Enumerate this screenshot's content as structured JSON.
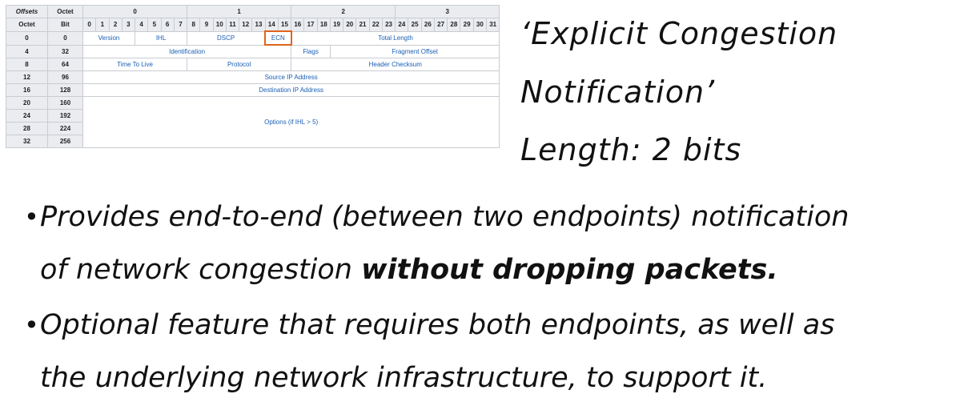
{
  "table": {
    "corner_offsets": "Offsets",
    "corner_octet": "Octet",
    "row_octet_label": "Octet",
    "row_bit_label": "Bit",
    "octet_headers": [
      "0",
      "1",
      "2",
      "3"
    ],
    "bit_headers": [
      "0",
      "1",
      "2",
      "3",
      "4",
      "5",
      "6",
      "7",
      "8",
      "9",
      "10",
      "11",
      "12",
      "13",
      "14",
      "15",
      "16",
      "17",
      "18",
      "19",
      "20",
      "21",
      "22",
      "23",
      "24",
      "25",
      "26",
      "27",
      "28",
      "29",
      "30",
      "31"
    ],
    "rows": [
      {
        "octet": "0",
        "bit": "0",
        "fields": [
          {
            "label": "Version",
            "span": 4
          },
          {
            "label": "IHL",
            "span": 4
          },
          {
            "label": "DSCP",
            "span": 6
          },
          {
            "label": "ECN",
            "span": 2,
            "highlight": true
          },
          {
            "label": "Total Length",
            "span": 16
          }
        ]
      },
      {
        "octet": "4",
        "bit": "32",
        "fields": [
          {
            "label": "Identification",
            "span": 16
          },
          {
            "label": "Flags",
            "span": 3
          },
          {
            "label": "Fragment Offset",
            "span": 13
          }
        ]
      },
      {
        "octet": "8",
        "bit": "64",
        "fields": [
          {
            "label": "Time To Live",
            "span": 8
          },
          {
            "label": "Protocol",
            "span": 8
          },
          {
            "label": "Header Checksum",
            "span": 16
          }
        ]
      },
      {
        "octet": "12",
        "bit": "96",
        "fields": [
          {
            "label": "Source IP Address",
            "span": 32
          }
        ]
      },
      {
        "octet": "16",
        "bit": "128",
        "fields": [
          {
            "label": "Destination IP Address",
            "span": 32
          }
        ]
      },
      {
        "octet": "20",
        "bit": "160",
        "fields": [
          {
            "label": "Options (if IHL > 5)",
            "span": 32
          }
        ]
      },
      {
        "octet": "24",
        "bit": "192"
      },
      {
        "octet": "28",
        "bit": "224"
      },
      {
        "octet": "32",
        "bit": "256"
      }
    ],
    "highlight_color": "#e0641d",
    "field_text_color": "#1a5fb4"
  },
  "ecn_title": {
    "line1": "‘Explicit Congestion",
    "line2": "Notification’",
    "length": "Length: 2 bits"
  },
  "bullets": [
    {
      "line1": "Provides end-to-end (between two endpoints) notification",
      "line2_plain": "of network congestion ",
      "line2_bold": "without dropping packets."
    },
    {
      "line1": "Optional feature that requires both endpoints, as well as",
      "line2": "the underlying network infrastructure, to support it."
    }
  ]
}
